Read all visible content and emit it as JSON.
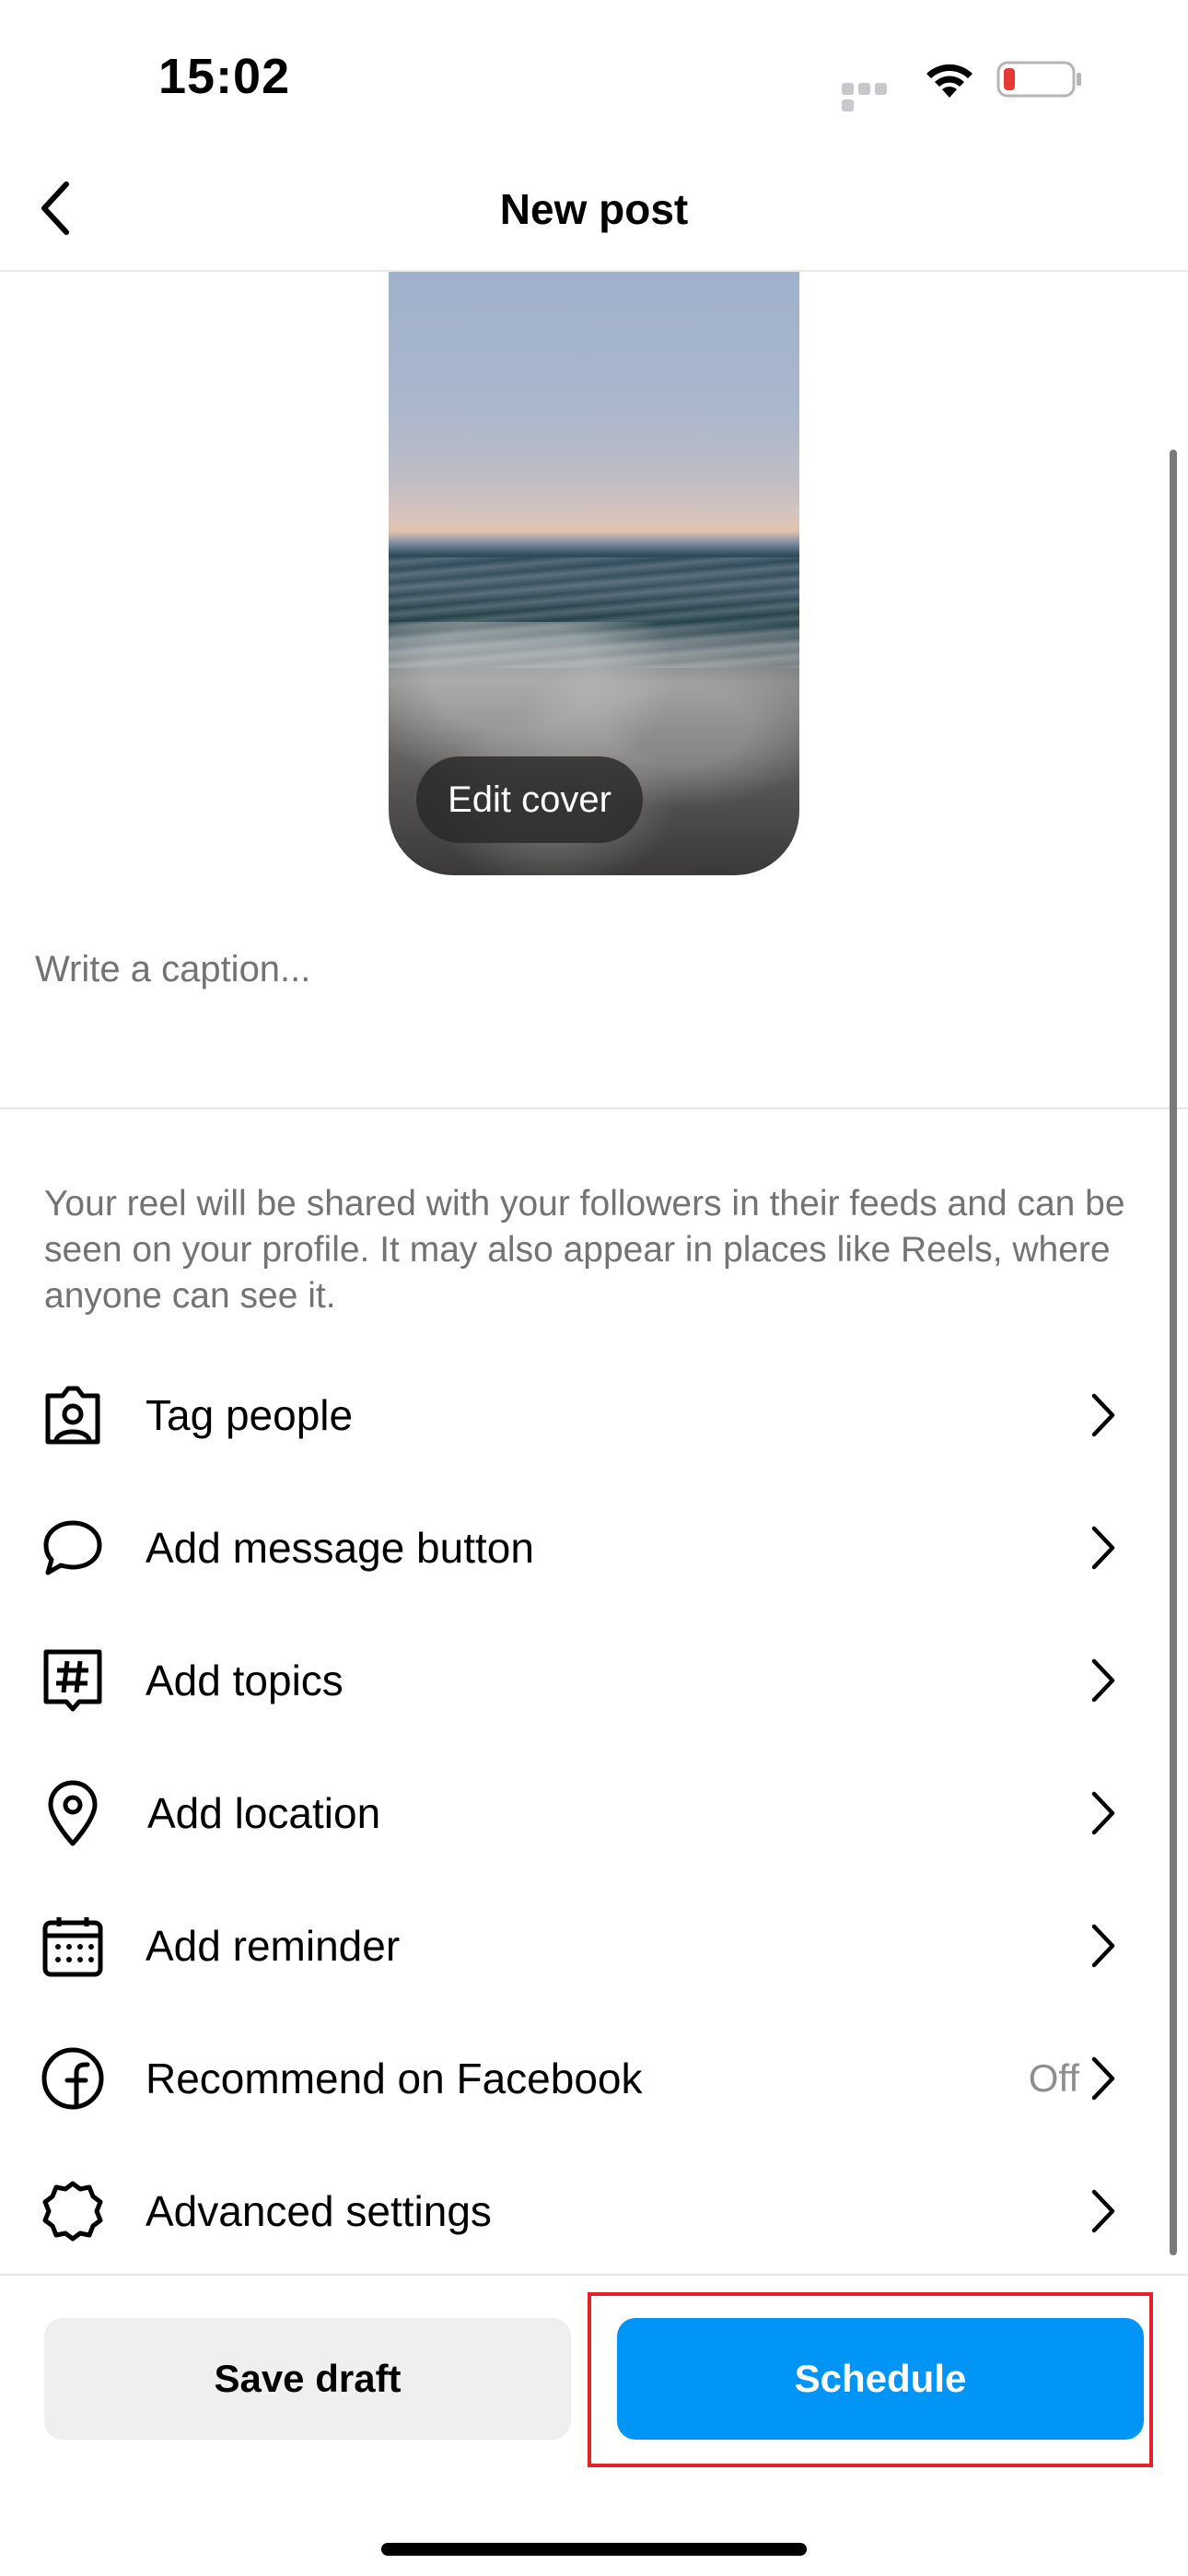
{
  "status_bar": {
    "time": "15:02",
    "battery_color": "#e53935"
  },
  "nav": {
    "title": "New post",
    "back_icon": "chevron-left-icon"
  },
  "cover": {
    "edit_label": "Edit cover"
  },
  "caption": {
    "placeholder": "Write a caption..."
  },
  "info_text": "Your reel will be shared with your followers in their feeds and can be seen on your profile. It may also appear in places like Reels, where anyone can see it.",
  "rows": [
    {
      "label": "Tag people",
      "icon": "tag-people-icon",
      "value": ""
    },
    {
      "label": "Add message button",
      "icon": "message-bubble-icon",
      "value": ""
    },
    {
      "label": "Add topics",
      "icon": "hashtag-icon",
      "value": ""
    },
    {
      "label": "Add location",
      "icon": "location-pin-icon",
      "value": ""
    },
    {
      "label": "Add reminder",
      "icon": "calendar-icon",
      "value": ""
    },
    {
      "label": "Recommend on Facebook",
      "icon": "facebook-icon",
      "value": "Off"
    },
    {
      "label": "Advanced settings",
      "icon": "gear-icon",
      "value": ""
    }
  ],
  "buttons": {
    "save_draft": "Save draft",
    "schedule": "Schedule"
  },
  "colors": {
    "accent": "#0095f6",
    "highlight": "#e3212b"
  }
}
